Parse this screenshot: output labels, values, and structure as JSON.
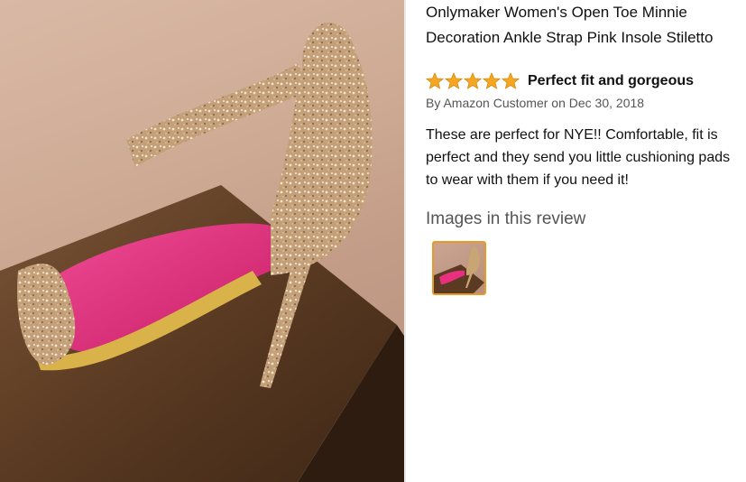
{
  "product": {
    "title_line1": "Onlymaker Women's Open Toe Minnie",
    "title_line2": "Decoration Ankle Strap Pink Insole Stiletto"
  },
  "review": {
    "rating": 5,
    "rating_max": 5,
    "title": "Perfect fit and gorgeous",
    "by_prefix": "By",
    "author": "Amazon Customer",
    "date_prefix": "on",
    "date": "Dec 30, 2018",
    "body": "These are perfect for NYE!! Comfortable, fit is perfect and they send you little cushioning pads to wear with them if you need it!",
    "images_heading": "Images in this review"
  },
  "colors": {
    "star": "#f5a623",
    "thumb_border": "#e69a28",
    "insole_pink": "#e8307e",
    "glitter_gold": "#c9a574",
    "box_brown": "#5a3a22"
  },
  "icons": {
    "star": "star-icon"
  }
}
